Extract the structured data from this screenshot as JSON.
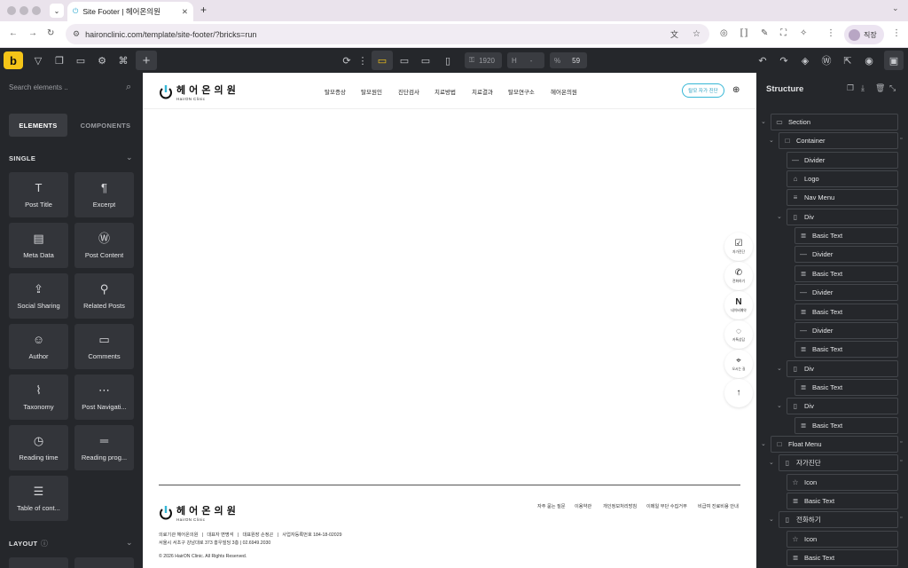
{
  "browser": {
    "tab_title": "Site Footer | 헤어온의원",
    "url": "haironclinic.com/template/site-footer/?bricks=run",
    "profile_label": "직장"
  },
  "toolbar": {
    "width_value": "1920",
    "height_label": "H",
    "height_value": "-",
    "scale_label": "%",
    "scale_value": "59"
  },
  "left_panel": {
    "search_placeholder": "Search elements ..",
    "tab_elements": "ELEMENTS",
    "tab_components": "COMPONENTS",
    "section_single": "SINGLE",
    "section_layout": "LAYOUT",
    "tiles": [
      {
        "label": "Post Title",
        "icon": "title-icon"
      },
      {
        "label": "Excerpt",
        "icon": "paragraph-icon"
      },
      {
        "label": "Meta Data",
        "icon": "document-icon"
      },
      {
        "label": "Post Content",
        "icon": "wordpress-icon"
      },
      {
        "label": "Social Sharing",
        "icon": "share-icon"
      },
      {
        "label": "Related Posts",
        "icon": "pin-icon"
      },
      {
        "label": "Author",
        "icon": "user-icon"
      },
      {
        "label": "Comments",
        "icon": "comment-icon"
      },
      {
        "label": "Taxonomy",
        "icon": "paperclip-icon"
      },
      {
        "label": "Post Navigati...",
        "icon": "dots-icon"
      },
      {
        "label": "Reading time",
        "icon": "clock-icon"
      },
      {
        "label": "Reading prog...",
        "icon": "progress-icon"
      },
      {
        "label": "Table of cont...",
        "icon": "list-icon"
      }
    ]
  },
  "canvas": {
    "logo_text": "헤 어 온 의 원",
    "logo_sub": "HairON Clinic",
    "nav": [
      "탈모증상",
      "탈모원인",
      "진단검사",
      "치료방법",
      "치료결과",
      "탈모연구소",
      "헤어온의원"
    ],
    "cta": "탈모 자가 진단",
    "float_menu": [
      {
        "icon": "check-circle-icon",
        "label": "자가진단"
      },
      {
        "icon": "phone-icon",
        "label": "전화하기"
      },
      {
        "icon": "naver-icon",
        "label": "네이버예약"
      },
      {
        "icon": "kakao-icon",
        "label": "카톡상담"
      },
      {
        "icon": "map-pin-icon",
        "label": "오시는 길"
      },
      {
        "icon": "arrow-up-icon",
        "label": ""
      }
    ],
    "footer": {
      "logo_text": "헤 어 온 의 원",
      "logo_sub": "HairON Clinic",
      "links": [
        "자주 묻는 질문",
        "이용약관",
        "개인정보처리방침",
        "이메일 무단 수집거부",
        "비급여 진료비용 안내"
      ],
      "line1": "의료기관 헤어온의원   |   대표자 변명석   |   대표원장 손정곤   |   사업자등록번호 184-18-02029",
      "line2": "서울시 서초구 강남대로 373 홍우빌딩 3층 | 02.6949.2030",
      "copyright": "© 2026 HairON Clinic. All Rights Reserved."
    }
  },
  "structure": {
    "title": "Structure",
    "items": [
      {
        "label": "Section",
        "depth": 0,
        "toggle": "v",
        "icon": "section-icon"
      },
      {
        "label": "Container",
        "depth": 1,
        "toggle": "v",
        "icon": "container-icon"
      },
      {
        "label": "Divider",
        "depth": 2,
        "toggle": "",
        "icon": "divider-icon"
      },
      {
        "label": "Logo",
        "depth": 2,
        "toggle": "",
        "icon": "image-icon"
      },
      {
        "label": "Nav Menu",
        "depth": 2,
        "toggle": "",
        "icon": "menu-icon"
      },
      {
        "label": "Div",
        "depth": 2,
        "toggle": "v",
        "icon": "div-icon"
      },
      {
        "label": "Basic Text",
        "depth": 3,
        "toggle": "",
        "icon": "text-icon"
      },
      {
        "label": "Divider",
        "depth": 3,
        "toggle": "",
        "icon": "divider-icon"
      },
      {
        "label": "Basic Text",
        "depth": 3,
        "toggle": "",
        "icon": "text-icon"
      },
      {
        "label": "Divider",
        "depth": 3,
        "toggle": "",
        "icon": "divider-icon"
      },
      {
        "label": "Basic Text",
        "depth": 3,
        "toggle": "",
        "icon": "text-icon"
      },
      {
        "label": "Divider",
        "depth": 3,
        "toggle": "",
        "icon": "divider-icon"
      },
      {
        "label": "Basic Text",
        "depth": 3,
        "toggle": "",
        "icon": "text-icon"
      },
      {
        "label": "Div",
        "depth": 2,
        "toggle": "v",
        "icon": "div-icon"
      },
      {
        "label": "Basic Text",
        "depth": 3,
        "toggle": "",
        "icon": "text-icon"
      },
      {
        "label": "Div",
        "depth": 2,
        "toggle": "v",
        "icon": "div-icon"
      },
      {
        "label": "Basic Text",
        "depth": 3,
        "toggle": "",
        "icon": "text-icon"
      },
      {
        "label": "Float Menu",
        "depth": 0,
        "toggle": "v",
        "icon": "container-icon"
      },
      {
        "label": "자가진단",
        "depth": 1,
        "toggle": "v",
        "icon": "div-icon"
      },
      {
        "label": "Icon",
        "depth": 2,
        "toggle": "",
        "icon": "star-icon"
      },
      {
        "label": "Basic Text",
        "depth": 2,
        "toggle": "",
        "icon": "text-icon"
      },
      {
        "label": "전화하기",
        "depth": 1,
        "toggle": "v",
        "icon": "div-icon"
      },
      {
        "label": "Icon",
        "depth": 2,
        "toggle": "",
        "icon": "star-icon"
      },
      {
        "label": "Basic Text",
        "depth": 2,
        "toggle": "",
        "icon": "text-icon"
      }
    ]
  },
  "colors": {
    "brand_yellow": "#f5c518",
    "accent_cyan": "#36b7d6",
    "panel_bg": "#25272b"
  }
}
